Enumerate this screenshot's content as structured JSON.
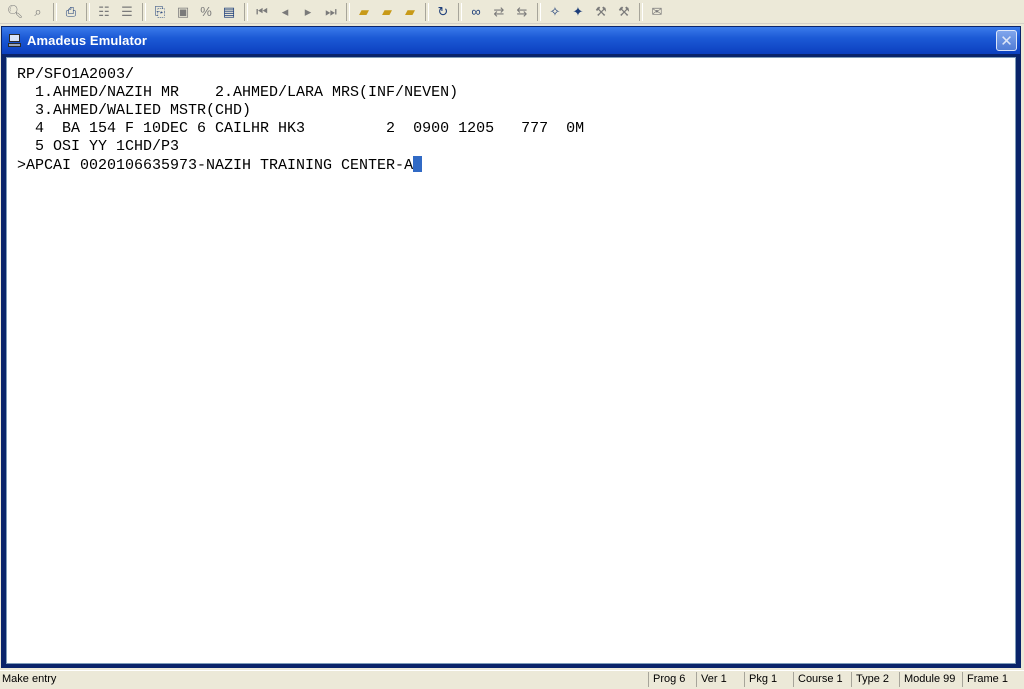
{
  "toolbar": {
    "icons": [
      "find-icon",
      "find-next-icon",
      "print-icon",
      "grid-icon",
      "table-icon",
      "copy-icon",
      "stack-icon",
      "percent-icon",
      "book-icon",
      "first-icon",
      "previous-icon",
      "next-icon",
      "last-icon",
      "open-folder-icon",
      "open-folder-down-icon",
      "open-folder-up-icon",
      "refresh-icon",
      "binoculars-icon",
      "transfer-icon",
      "transfer-back-icon",
      "wand-icon",
      "wand-arrow-icon",
      "tools-icon",
      "tools-arrow-icon",
      "mail-icon"
    ]
  },
  "window": {
    "title": "Amadeus Emulator",
    "close_label": "✕"
  },
  "terminal": {
    "lines": [
      "RP/SFO1A2003/",
      "  1.AHMED/NAZIH MR    2.AHMED/LARA MRS(INF/NEVEN)",
      "  3.AHMED/WALIED MSTR(CHD)",
      "  4  BA 154 F 10DEC 6 CAILHR HK3         2  0900 1205   777  0M",
      "  5 OSI YY 1CHD/P3"
    ],
    "entry": ">APCAI 0020106635973-NAZIH TRAINING CENTER-A"
  },
  "status": {
    "message": "Make entry",
    "prog": "Prog 6",
    "ver": "Ver 1",
    "pkg": "Pkg 1",
    "course": "Course 1",
    "type": "Type 2",
    "module": "Module 99",
    "frame": "Frame 1"
  },
  "colors": {
    "title_bar": "#0c3fbf",
    "cursor": "#316ac5",
    "background": "#ece9d8"
  }
}
